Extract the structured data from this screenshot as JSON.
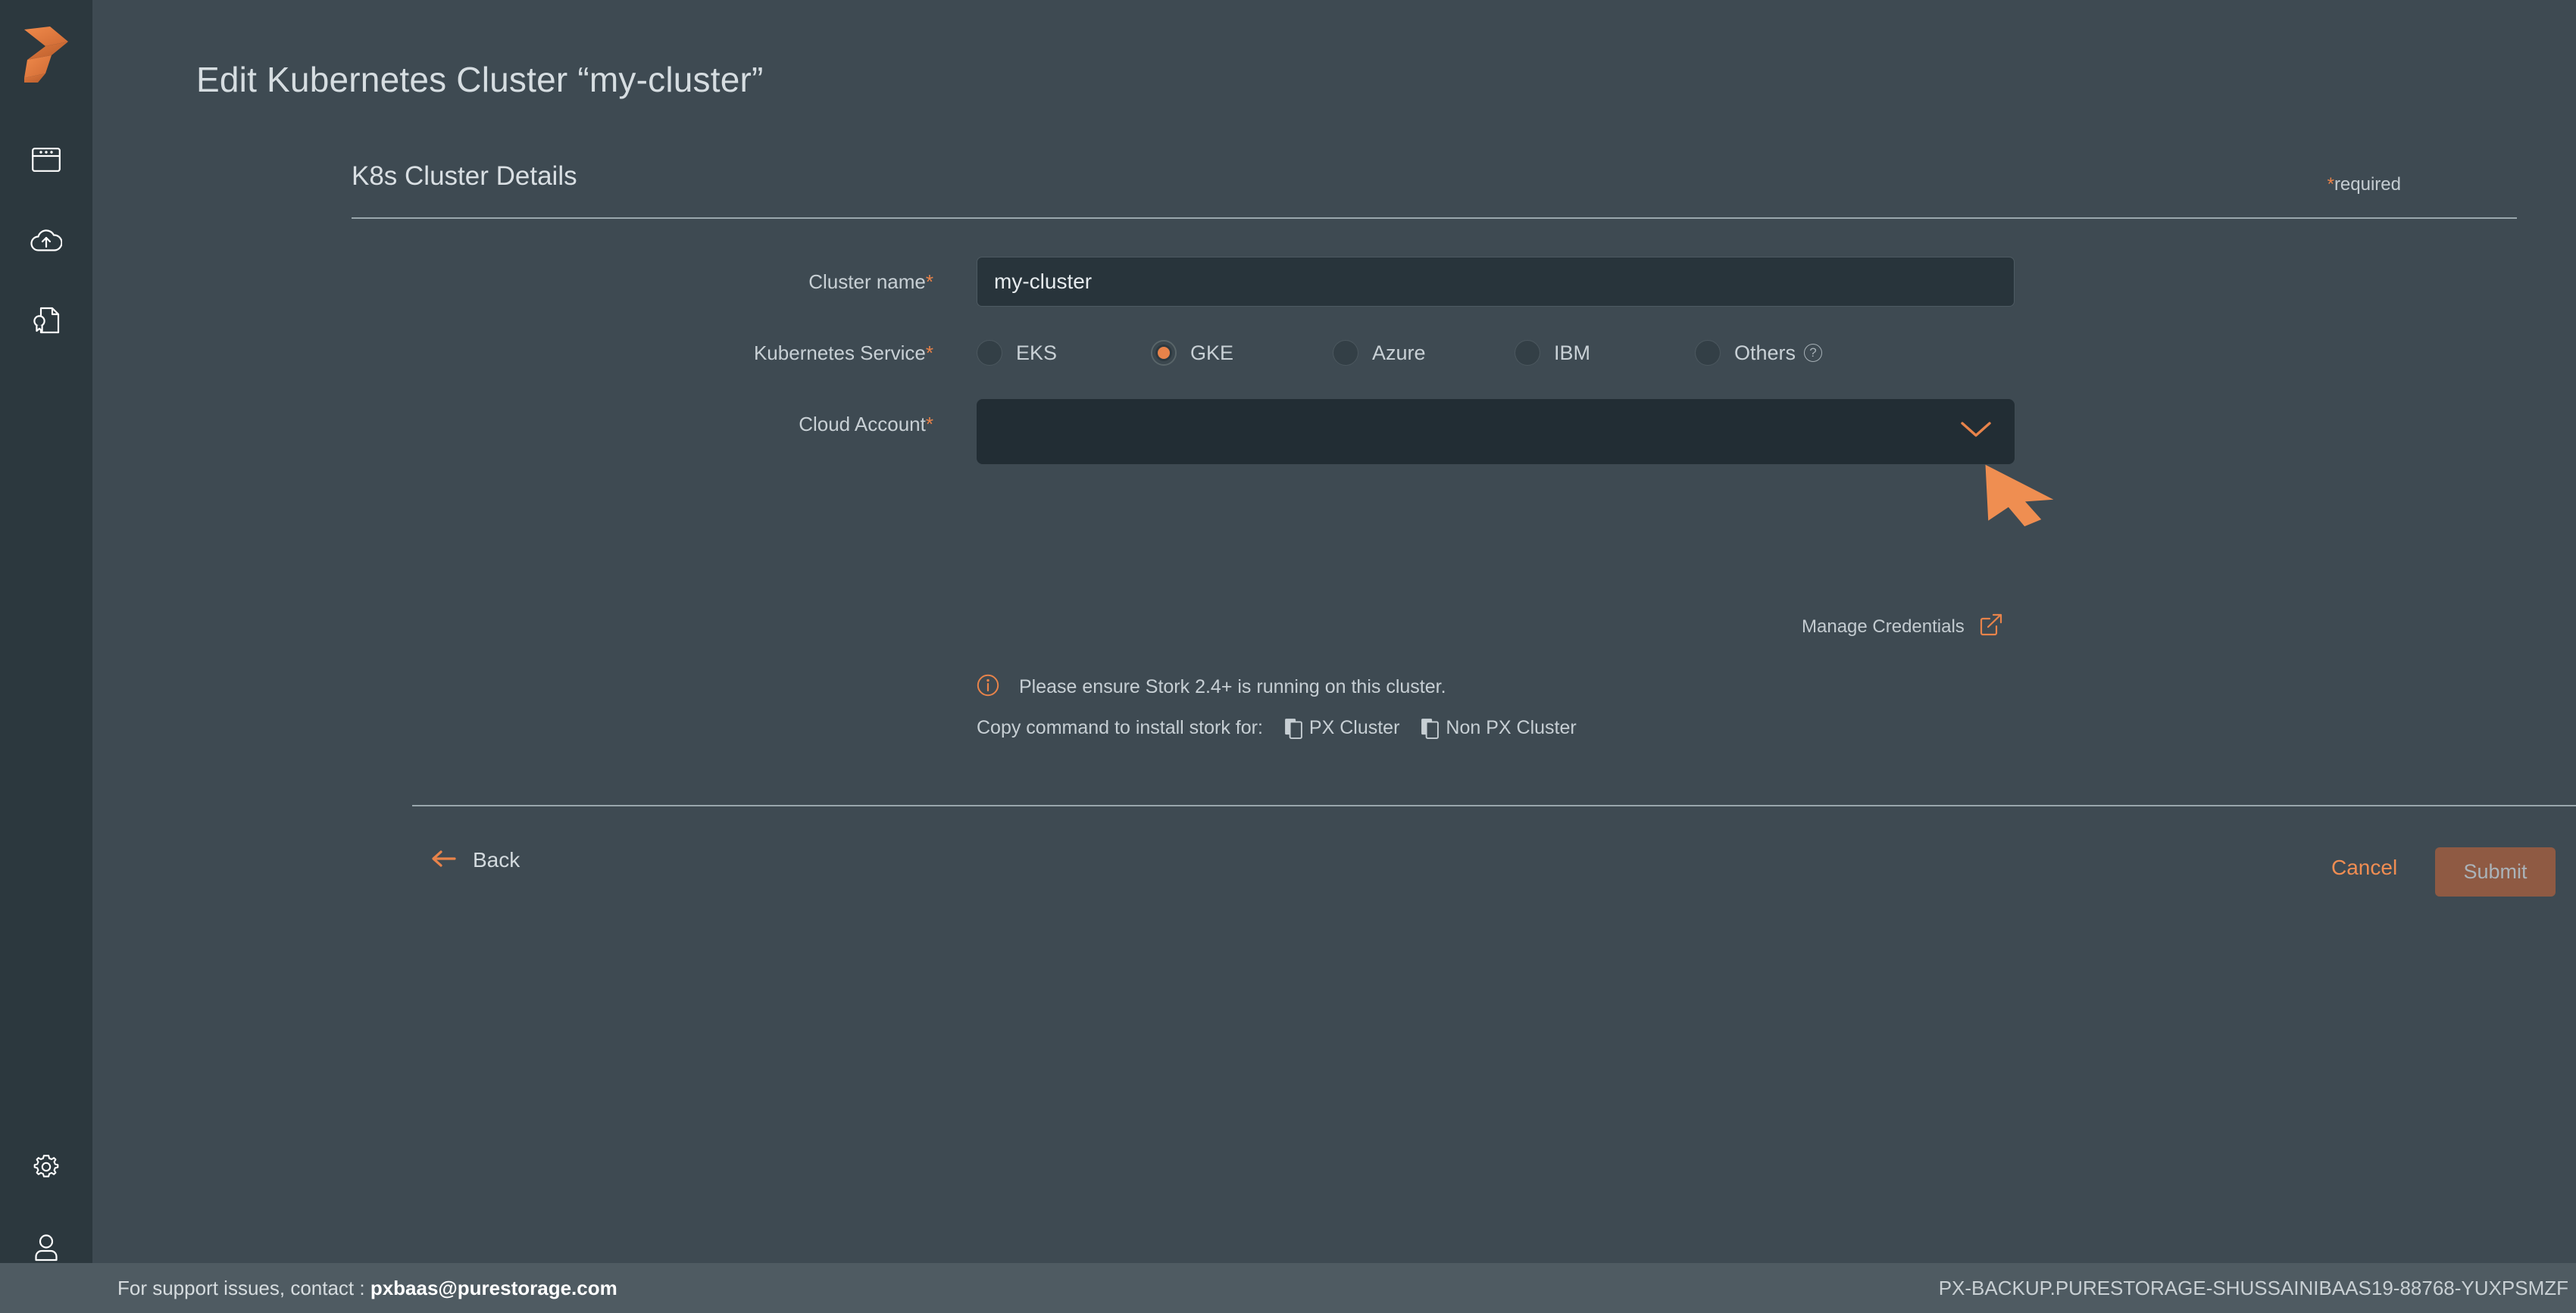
{
  "sidebar": {
    "logo_name": "portworx-logo",
    "items": [
      {
        "icon": "dashboard-window-icon",
        "name": "sidebar-item-dashboard"
      },
      {
        "icon": "cloud-upload-icon",
        "name": "sidebar-item-backup"
      },
      {
        "icon": "license-certificate-icon",
        "name": "sidebar-item-license"
      }
    ],
    "bottom_items": [
      {
        "icon": "gear-icon",
        "name": "sidebar-item-settings"
      },
      {
        "icon": "user-icon",
        "name": "sidebar-item-account"
      }
    ]
  },
  "page": {
    "title": "Edit Kubernetes Cluster “my-cluster”"
  },
  "form": {
    "section_title": "K8s Cluster Details",
    "required_star": "*",
    "required_note": "required",
    "cluster_name": {
      "label": "Cluster name",
      "required_star": "*",
      "value": "my-cluster",
      "placeholder": ""
    },
    "kubernetes_service": {
      "label": "Kubernetes Service",
      "required_star": "*",
      "selected": "GKE",
      "options": [
        {
          "label": "EKS",
          "selected": false,
          "has_help": false
        },
        {
          "label": "GKE",
          "selected": true,
          "has_help": false
        },
        {
          "label": "Azure",
          "selected": false,
          "has_help": false
        },
        {
          "label": "IBM",
          "selected": false,
          "has_help": false
        },
        {
          "label": "Others",
          "selected": false,
          "has_help": true
        }
      ],
      "help_glyph": "?"
    },
    "cloud_account": {
      "label": "Cloud Account",
      "required_star": "*",
      "value": "",
      "placeholder": "",
      "chevron_icon": "chevron-down-icon"
    },
    "manage_credentials": {
      "label": "Manage Credentials",
      "icon": "external-link-icon"
    },
    "stork": {
      "info_icon": "info-circle-icon",
      "message": "Please ensure Stork 2.4+ is running on this cluster.",
      "copy_prefix": "Copy command to install stork for:",
      "copy_links": [
        {
          "label": "PX Cluster",
          "icon": "copy-icon"
        },
        {
          "label": "Non PX Cluster",
          "icon": "copy-icon"
        }
      ]
    }
  },
  "actions": {
    "back": {
      "label": "Back",
      "icon": "arrow-left-icon"
    },
    "cancel": {
      "label": "Cancel"
    },
    "submit": {
      "label": "Submit",
      "disabled": true
    }
  },
  "footer": {
    "support_text": "For support issues, contact : ",
    "support_email": "pxbaas@purestorage.com",
    "instance_id": "PX-BACKUP.PURESTORAGE-SHUSSAINIBAAS19-88768-YUXPSMZF"
  },
  "cursor": {
    "name": "mouse-cursor",
    "color": "#ef8e51"
  },
  "colors": {
    "accent": "#e8834a",
    "background": "#3e4a52",
    "sidebar": "#2c383e",
    "field": "#28343b",
    "footer": "#4f5b62"
  }
}
